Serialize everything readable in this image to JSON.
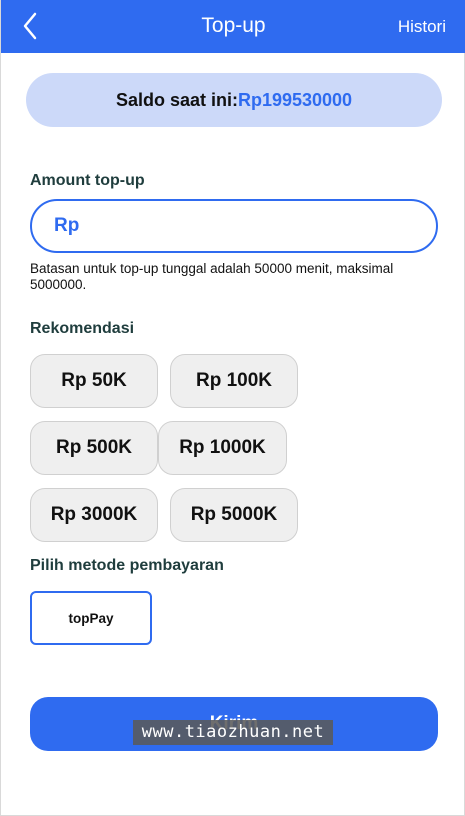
{
  "header": {
    "title": "Top-up",
    "history_label": "Histori"
  },
  "balance": {
    "label": "Saldo saat ini:",
    "value": "Rp199530000"
  },
  "amount": {
    "label": "Amount top-up",
    "prefix": "Rp",
    "value": "",
    "placeholder": "",
    "note": "Batasan untuk top-up tunggal adalah 50000 menit, maksimal 5000000."
  },
  "recommendations": {
    "label": "Rekomendasi",
    "options": [
      "Rp 50K",
      "Rp 100K",
      "Rp 500K",
      "Rp 1000K",
      "Rp 3000K",
      "Rp 5000K"
    ]
  },
  "payment": {
    "label": "Pilih metode pembayaran",
    "methods": [
      "topPay"
    ]
  },
  "submit": {
    "label": "Kirim"
  },
  "watermark": {
    "text": "www.tiaozhuan.net"
  },
  "colors": {
    "primary": "#2f6bf0",
    "balance_bg": "#ccd9f9",
    "chip_bg": "#efefef"
  }
}
